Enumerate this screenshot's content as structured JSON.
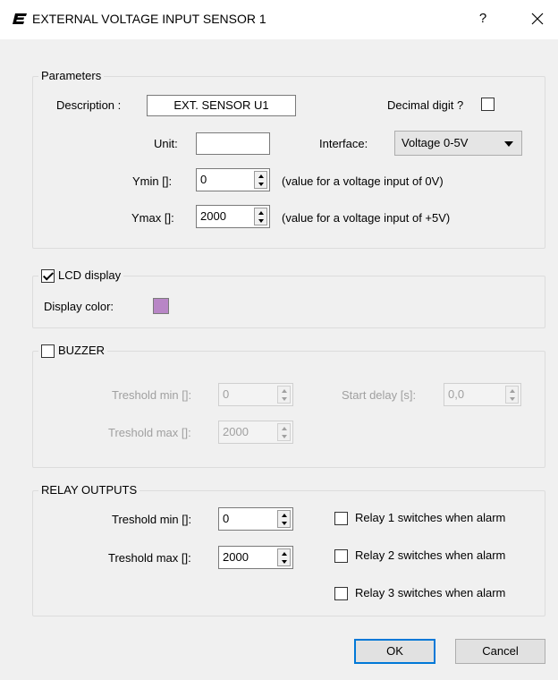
{
  "window": {
    "title": "EXTERNAL VOLTAGE INPUT SENSOR 1",
    "help_label": "?",
    "close_label": "✕"
  },
  "parameters": {
    "legend": "Parameters",
    "description_label": "Description :",
    "description_value": "EXT. SENSOR U1",
    "decimal_label": "Decimal digit ?",
    "decimal_checked": false,
    "unit_label": "Unit:",
    "unit_value": "",
    "interface_label": "Interface:",
    "interface_value": "Voltage 0-5V",
    "ymin_label": "Ymin []:",
    "ymin_value": "0",
    "ymin_note": "(value for a voltage input of 0V)",
    "ymax_label": "Ymax []:",
    "ymax_value": "2000",
    "ymax_note": "(value for a voltage input of +5V)"
  },
  "lcd": {
    "legend": "LCD display",
    "checked": true,
    "color_label": "Display color:",
    "color_value": "#b886c6"
  },
  "buzzer": {
    "legend": "BUZZER",
    "checked": false,
    "treshold_min_label": "Treshold min []:",
    "treshold_min_value": "0",
    "treshold_max_label": "Treshold max []:",
    "treshold_max_value": "2000",
    "start_delay_label": "Start delay [s]:",
    "start_delay_value": "0,0"
  },
  "relay": {
    "legend": "RELAY OUTPUTS",
    "treshold_min_label": "Treshold min []:",
    "treshold_min_value": "0",
    "treshold_max_label": "Treshold max []:",
    "treshold_max_value": "2000",
    "relay1_label": "Relay 1 switches when alarm",
    "relay2_label": "Relay 2 switches when alarm",
    "relay3_label": "Relay 3 switches when alarm"
  },
  "buttons": {
    "ok": "OK",
    "cancel": "Cancel"
  },
  "colors": {
    "accent": "#0078d7",
    "background": "#f0f0f0"
  }
}
